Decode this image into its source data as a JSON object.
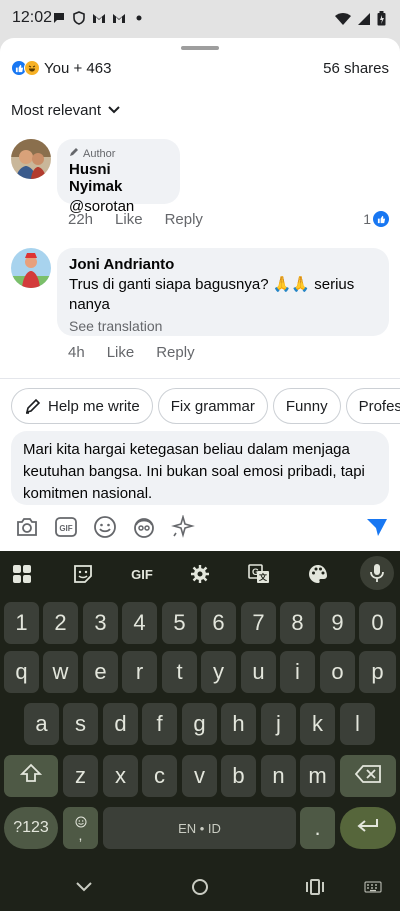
{
  "status_bar": {
    "time": "12:02",
    "notification_icons": [
      "chat-bubble-icon",
      "shield-vpn-icon",
      "gmail-icon",
      "gmail-icon",
      "dot-icon"
    ],
    "right_icons": [
      "wifi-icon",
      "signal-icon",
      "battery-icon"
    ]
  },
  "reactions": {
    "icons": [
      "like-reaction-icon",
      "haha-reaction-icon"
    ],
    "summary": "You + 463",
    "shares": "56 shares"
  },
  "sort": {
    "label": "Most relevant"
  },
  "comments": [
    {
      "badge": "Author",
      "name": "Husni Nyimak",
      "text": "@sorotan",
      "time": "22h",
      "like_label": "Like",
      "reply_label": "Reply",
      "like_count": "1"
    },
    {
      "name": "Joni Andrianto",
      "text": "Trus di ganti siapa bagusnya? 🙏🙏 serius nanya",
      "see_translation": "See translation",
      "time": "4h",
      "like_label": "Like",
      "reply_label": "Reply"
    }
  ],
  "suggestions": [
    "Help me write",
    "Fix grammar",
    "Funny",
    "Profess"
  ],
  "compose": {
    "text": "Mari kita hargai ketegasan beliau dalam menjaga keutuhan bangsa. Ini bukan soal emosi pribadi, tapi komitmen nasional."
  },
  "compose_tools": [
    "camera-icon",
    "gif-icon",
    "emoji-icon",
    "avatar-sticker-icon",
    "sparkle-icon",
    "send-icon"
  ],
  "keyboard": {
    "toolbar": [
      "apps-grid-icon",
      "sticker-icon",
      "GIF",
      "settings-gear-icon",
      "translate-icon",
      "palette-icon",
      "mic-icon"
    ],
    "gif_label": "GIF",
    "row_numbers": [
      "1",
      "2",
      "3",
      "4",
      "5",
      "6",
      "7",
      "8",
      "9",
      "0"
    ],
    "row_1": [
      "q",
      "w",
      "e",
      "r",
      "t",
      "y",
      "u",
      "i",
      "o",
      "p"
    ],
    "row_2": [
      "a",
      "s",
      "d",
      "f",
      "g",
      "h",
      "j",
      "k",
      "l"
    ],
    "row_3": [
      "z",
      "x",
      "c",
      "v",
      "b",
      "n",
      "m"
    ],
    "symbols_label": "?123",
    "emoji_comma": ",",
    "space_label": "EN • ID",
    "period": "."
  },
  "nav_bar": [
    "back-chevron-icon",
    "home-circle-icon",
    "recents-icon",
    "keyboard-switch-icon"
  ],
  "colors": {
    "facebook_blue": "#1877f2",
    "bubble_gray": "#f0f2f5",
    "keyboard_bg": "#1e2219",
    "key_bg": "#3b3f38",
    "action_key_bg": "#56663b"
  }
}
